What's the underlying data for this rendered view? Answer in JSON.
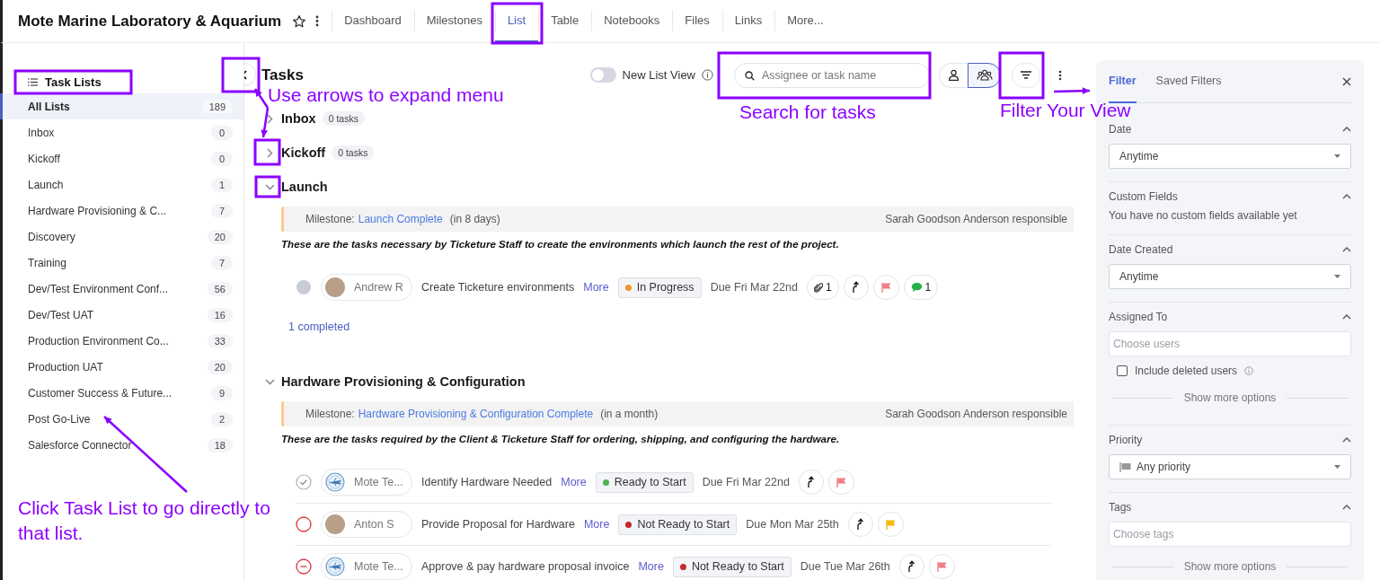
{
  "project": {
    "title": "Mote Marine Laboratory & Aquarium"
  },
  "nav_tabs": [
    {
      "label": "Dashboard",
      "selected": false
    },
    {
      "label": "Milestones",
      "selected": false
    },
    {
      "label": "List",
      "selected": true
    },
    {
      "label": "Table",
      "selected": false
    },
    {
      "label": "Notebooks",
      "selected": false
    },
    {
      "label": "Files",
      "selected": false
    },
    {
      "label": "Links",
      "selected": false
    },
    {
      "label": "More...",
      "selected": false
    }
  ],
  "sidebar": {
    "title": "Task Lists",
    "items": [
      {
        "label": "All Lists",
        "count": "189",
        "selected": true
      },
      {
        "label": "Inbox",
        "count": "0",
        "selected": false
      },
      {
        "label": "Kickoff",
        "count": "0",
        "selected": false
      },
      {
        "label": "Launch",
        "count": "1",
        "selected": false
      },
      {
        "label": "Hardware Provisioning & C...",
        "count": "7",
        "selected": false
      },
      {
        "label": "Discovery",
        "count": "20",
        "selected": false
      },
      {
        "label": "Training",
        "count": "7",
        "selected": false
      },
      {
        "label": "Dev/Test Environment Conf...",
        "count": "56",
        "selected": false
      },
      {
        "label": "Dev/Test UAT",
        "count": "16",
        "selected": false
      },
      {
        "label": "Production Environment Co...",
        "count": "33",
        "selected": false
      },
      {
        "label": "Production UAT",
        "count": "20",
        "selected": false
      },
      {
        "label": "Customer Success & Future...",
        "count": "9",
        "selected": false
      },
      {
        "label": "Post Go-Live",
        "count": "2",
        "selected": false
      },
      {
        "label": "Salesforce Connector",
        "count": "18",
        "selected": false
      }
    ]
  },
  "toolbar": {
    "title": "Tasks",
    "new_list_view": {
      "label": "New List View",
      "on": false
    },
    "search": {
      "placeholder": "Assignee or task name"
    },
    "view_toggle": [
      {
        "kind": "person",
        "selected": false
      },
      {
        "kind": "group",
        "selected": true
      }
    ]
  },
  "task_lists": [
    {
      "name": "Inbox",
      "count": "0 tasks",
      "expanded": false
    },
    {
      "name": "Kickoff",
      "count": "0 tasks",
      "expanded": false
    },
    {
      "name": "Launch",
      "expanded": true,
      "milestone": {
        "label": "Milestone:",
        "link": "Launch Complete",
        "due": "(in 8 days)",
        "responsible": "Sarah Goodson Anderson responsible"
      },
      "description": "These are the tasks necessary by Ticketure Staff to create the environments which launch the rest of the project.",
      "tasks": [
        {
          "kind": "pending",
          "avatar": {
            "kind": "photo"
          },
          "assignee": "Andrew R",
          "title": "Create Ticketure environments",
          "more": "More",
          "status": {
            "label": "In Progress",
            "color": "#f0932b"
          },
          "due": "Due Fri Mar 22nd",
          "attachments": "1",
          "priority": {
            "color": "#ef7f86"
          },
          "comments": "1"
        }
      ],
      "completed": "1 completed"
    },
    {
      "name": "Hardware Provisioning & Configuration",
      "expanded": true,
      "milestone": {
        "label": "Milestone:",
        "link": "Hardware Provisioning & Configuration Complete",
        "due": "(in a month)",
        "responsible": "Sarah Goodson Anderson responsible"
      },
      "description": "These are the tasks required by the Client & Ticketure Staff for ordering, shipping, and configuring the hardware.",
      "tasks": [
        {
          "kind": "check",
          "avatar": {
            "kind": "logo"
          },
          "assignee": "Mote Te...",
          "title": "Identify Hardware Needed",
          "more": "More",
          "status": {
            "label": "Ready to Start",
            "color": "#4cb050"
          },
          "due": "Due Fri Mar 22nd",
          "priority": {
            "color": "#ef7f86"
          }
        },
        {
          "kind": "open",
          "avatar": {
            "kind": "photo"
          },
          "assignee": "Anton S",
          "title": "Provide Proposal for Hardware",
          "more": "More",
          "status": {
            "label": "Not Ready to Start",
            "color": "#c62828"
          },
          "due": "Due Mon Mar 25th",
          "priority": {
            "color": "#f5b800"
          }
        },
        {
          "kind": "minus",
          "avatar": {
            "kind": "logo"
          },
          "assignee": "Mote Te...",
          "title": "Approve & pay hardware proposal invoice",
          "more": "More",
          "status": {
            "label": "Not Ready to Start",
            "color": "#c62828"
          },
          "due": "Due Tue Mar 26th",
          "priority": {
            "color": "#ef7f86"
          }
        }
      ]
    }
  ],
  "filter_panel": {
    "tabs": [
      {
        "label": "Filter",
        "selected": true
      },
      {
        "label": "Saved Filters",
        "selected": false
      }
    ],
    "sections": [
      {
        "title": "Date",
        "kind": "select",
        "value": "Anytime",
        "expanded": true
      },
      {
        "title": "Custom Fields",
        "kind": "note",
        "text": "You have no custom fields available yet",
        "expanded": true
      },
      {
        "title": "Date Created",
        "kind": "select",
        "value": "Anytime",
        "expanded": true
      },
      {
        "title": "Assigned To",
        "kind": "users",
        "placeholder": "Choose users",
        "checkbox": {
          "label": "Include deleted users",
          "checked": false
        },
        "more": "Show more options",
        "expanded": true
      },
      {
        "title": "Priority",
        "kind": "priority",
        "value": "Any priority",
        "expanded": true
      },
      {
        "title": "Tags",
        "kind": "tags",
        "placeholder": "Choose tags",
        "more": "Show more options",
        "expanded": true
      }
    ]
  },
  "annotations": [
    {
      "text": "Use arrows to expand menu"
    },
    {
      "text": "Search for tasks"
    },
    {
      "text": "Filter Your View"
    },
    {
      "text": "Click Task List to go directly to that list."
    }
  ]
}
